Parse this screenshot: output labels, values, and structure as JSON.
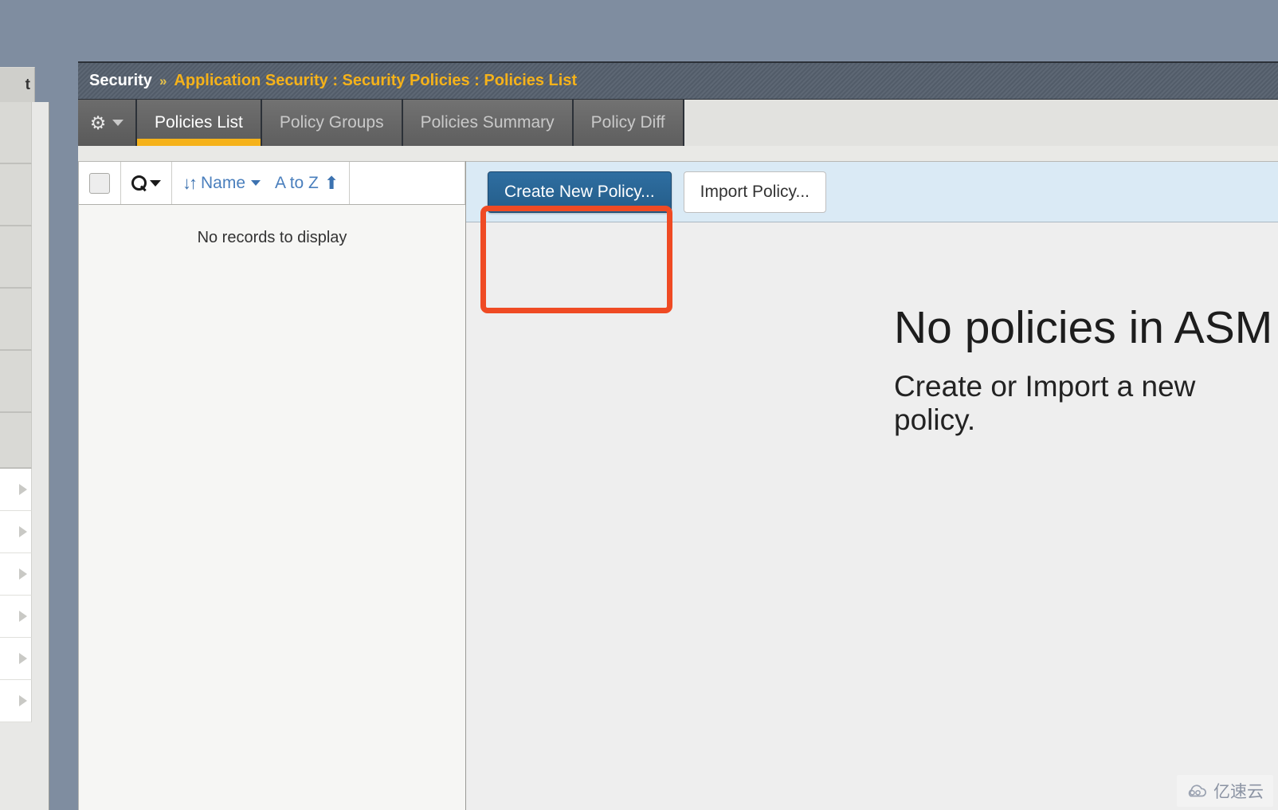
{
  "left_rail": {
    "tab_label": "t",
    "section_count": 6,
    "row_count": 6,
    "row_icon": "triangle-right-icon"
  },
  "breadcrumb": {
    "root": "Security",
    "separator": "»",
    "path": "Application Security : Security Policies : Policies List"
  },
  "tabs": {
    "gear_icon": "gear-icon",
    "gear_caret_icon": "chevron-down-icon",
    "items": [
      {
        "label": "Policies List",
        "active": true
      },
      {
        "label": "Policy Groups",
        "active": false
      },
      {
        "label": "Policies Summary",
        "active": false
      },
      {
        "label": "Policy Diff",
        "active": false
      }
    ]
  },
  "list_panel": {
    "toolbar": {
      "select_all_checkbox": "select-all-checkbox",
      "search_icon": "search-icon",
      "search_caret_icon": "chevron-down-icon",
      "sort_icon": "sort-updown-icon",
      "sort_field_label": "Name",
      "sort_field_caret_icon": "chevron-down-icon",
      "sort_direction_label": "A to Z",
      "sort_direction_icon": "arrow-up-icon"
    },
    "empty_text": "No records to display"
  },
  "detail_panel": {
    "create_button_label": "Create New Policy...",
    "import_button_label": "Import Policy...",
    "empty_title": "No policies in ASM",
    "empty_subtitle": "Create or Import a new policy."
  },
  "annotation": {
    "shape": "rounded-rectangle-highlight",
    "color": "#ef4a23",
    "targets": "create-new-policy-button"
  },
  "watermark": {
    "icon": "cloud-icon",
    "text": "亿速云"
  },
  "colors": {
    "page_background": "#7f8da0",
    "breadcrumb_background": "#56606e",
    "breadcrumb_accent": "#f5b21a",
    "tab_active_underline": "#f5b21a",
    "primary_button": "#2e6ea1",
    "action_bar_background": "#daeaf5",
    "annotation": "#ef4a23"
  }
}
